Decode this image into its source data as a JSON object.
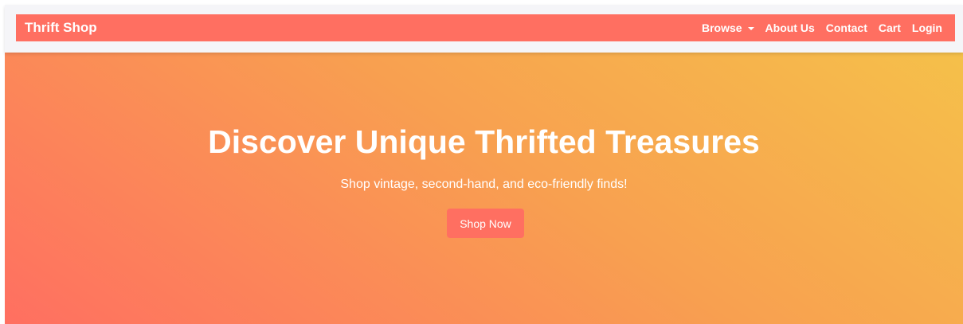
{
  "navbar": {
    "brand": "Thrift Shop",
    "links": {
      "browse": "Browse",
      "about": "About Us",
      "contact": "Contact",
      "cart": "Cart",
      "login": "Login"
    }
  },
  "hero": {
    "title": "Discover Unique Thrifted Treasures",
    "subtitle": "Shop vintage, second-hand, and eco-friendly finds!",
    "cta_label": "Shop Now"
  },
  "icons": {
    "browse_dropdown": "caret-down-icon"
  },
  "colors": {
    "accent": "#ff6f61",
    "gradient_start": "#ff6f61",
    "gradient_mid": "#f8a050",
    "gradient_end": "#f5c04a",
    "nav_shell_background": "#f5f5f8",
    "text_on_accent": "#ffffff"
  }
}
